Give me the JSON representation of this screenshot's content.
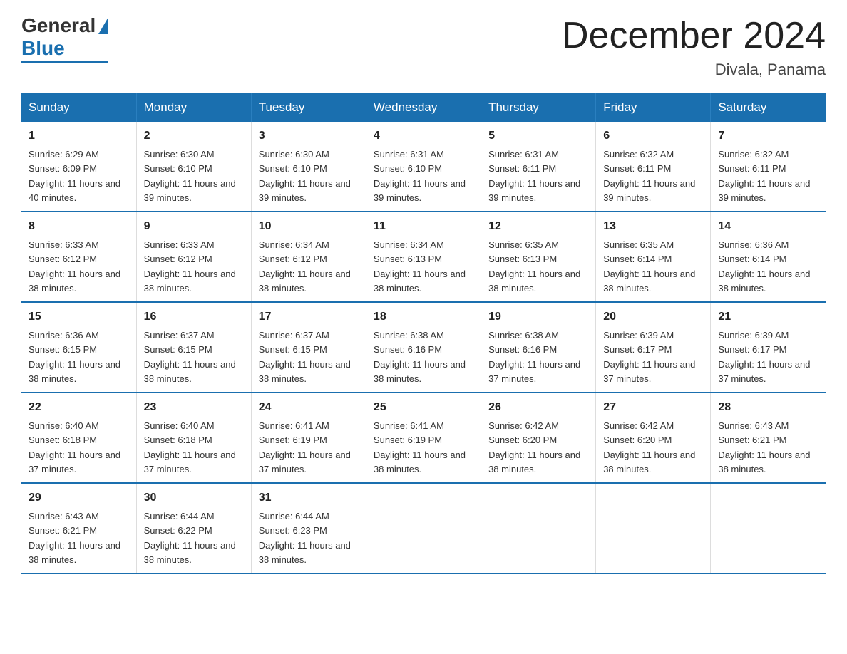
{
  "header": {
    "logo_general": "General",
    "logo_blue": "Blue",
    "month_title": "December 2024",
    "location": "Divala, Panama"
  },
  "days_of_week": [
    "Sunday",
    "Monday",
    "Tuesday",
    "Wednesday",
    "Thursday",
    "Friday",
    "Saturday"
  ],
  "weeks": [
    [
      {
        "day": "1",
        "sunrise": "6:29 AM",
        "sunset": "6:09 PM",
        "daylight": "11 hours and 40 minutes."
      },
      {
        "day": "2",
        "sunrise": "6:30 AM",
        "sunset": "6:10 PM",
        "daylight": "11 hours and 39 minutes."
      },
      {
        "day": "3",
        "sunrise": "6:30 AM",
        "sunset": "6:10 PM",
        "daylight": "11 hours and 39 minutes."
      },
      {
        "day": "4",
        "sunrise": "6:31 AM",
        "sunset": "6:10 PM",
        "daylight": "11 hours and 39 minutes."
      },
      {
        "day": "5",
        "sunrise": "6:31 AM",
        "sunset": "6:11 PM",
        "daylight": "11 hours and 39 minutes."
      },
      {
        "day": "6",
        "sunrise": "6:32 AM",
        "sunset": "6:11 PM",
        "daylight": "11 hours and 39 minutes."
      },
      {
        "day": "7",
        "sunrise": "6:32 AM",
        "sunset": "6:11 PM",
        "daylight": "11 hours and 39 minutes."
      }
    ],
    [
      {
        "day": "8",
        "sunrise": "6:33 AM",
        "sunset": "6:12 PM",
        "daylight": "11 hours and 38 minutes."
      },
      {
        "day": "9",
        "sunrise": "6:33 AM",
        "sunset": "6:12 PM",
        "daylight": "11 hours and 38 minutes."
      },
      {
        "day": "10",
        "sunrise": "6:34 AM",
        "sunset": "6:12 PM",
        "daylight": "11 hours and 38 minutes."
      },
      {
        "day": "11",
        "sunrise": "6:34 AM",
        "sunset": "6:13 PM",
        "daylight": "11 hours and 38 minutes."
      },
      {
        "day": "12",
        "sunrise": "6:35 AM",
        "sunset": "6:13 PM",
        "daylight": "11 hours and 38 minutes."
      },
      {
        "day": "13",
        "sunrise": "6:35 AM",
        "sunset": "6:14 PM",
        "daylight": "11 hours and 38 minutes."
      },
      {
        "day": "14",
        "sunrise": "6:36 AM",
        "sunset": "6:14 PM",
        "daylight": "11 hours and 38 minutes."
      }
    ],
    [
      {
        "day": "15",
        "sunrise": "6:36 AM",
        "sunset": "6:15 PM",
        "daylight": "11 hours and 38 minutes."
      },
      {
        "day": "16",
        "sunrise": "6:37 AM",
        "sunset": "6:15 PM",
        "daylight": "11 hours and 38 minutes."
      },
      {
        "day": "17",
        "sunrise": "6:37 AM",
        "sunset": "6:15 PM",
        "daylight": "11 hours and 38 minutes."
      },
      {
        "day": "18",
        "sunrise": "6:38 AM",
        "sunset": "6:16 PM",
        "daylight": "11 hours and 38 minutes."
      },
      {
        "day": "19",
        "sunrise": "6:38 AM",
        "sunset": "6:16 PM",
        "daylight": "11 hours and 37 minutes."
      },
      {
        "day": "20",
        "sunrise": "6:39 AM",
        "sunset": "6:17 PM",
        "daylight": "11 hours and 37 minutes."
      },
      {
        "day": "21",
        "sunrise": "6:39 AM",
        "sunset": "6:17 PM",
        "daylight": "11 hours and 37 minutes."
      }
    ],
    [
      {
        "day": "22",
        "sunrise": "6:40 AM",
        "sunset": "6:18 PM",
        "daylight": "11 hours and 37 minutes."
      },
      {
        "day": "23",
        "sunrise": "6:40 AM",
        "sunset": "6:18 PM",
        "daylight": "11 hours and 37 minutes."
      },
      {
        "day": "24",
        "sunrise": "6:41 AM",
        "sunset": "6:19 PM",
        "daylight": "11 hours and 37 minutes."
      },
      {
        "day": "25",
        "sunrise": "6:41 AM",
        "sunset": "6:19 PM",
        "daylight": "11 hours and 38 minutes."
      },
      {
        "day": "26",
        "sunrise": "6:42 AM",
        "sunset": "6:20 PM",
        "daylight": "11 hours and 38 minutes."
      },
      {
        "day": "27",
        "sunrise": "6:42 AM",
        "sunset": "6:20 PM",
        "daylight": "11 hours and 38 minutes."
      },
      {
        "day": "28",
        "sunrise": "6:43 AM",
        "sunset": "6:21 PM",
        "daylight": "11 hours and 38 minutes."
      }
    ],
    [
      {
        "day": "29",
        "sunrise": "6:43 AM",
        "sunset": "6:21 PM",
        "daylight": "11 hours and 38 minutes."
      },
      {
        "day": "30",
        "sunrise": "6:44 AM",
        "sunset": "6:22 PM",
        "daylight": "11 hours and 38 minutes."
      },
      {
        "day": "31",
        "sunrise": "6:44 AM",
        "sunset": "6:23 PM",
        "daylight": "11 hours and 38 minutes."
      },
      null,
      null,
      null,
      null
    ]
  ]
}
